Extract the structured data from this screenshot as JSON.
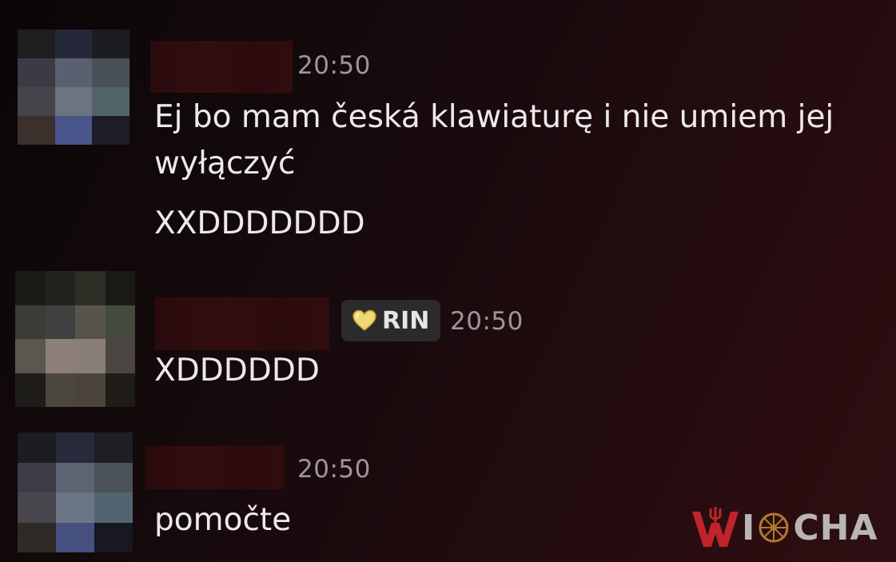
{
  "messages": [
    {
      "author_redacted": true,
      "time": "20:50",
      "lines": [
        "Ej bo mam česká klawiaturę i nie umiem jej",
        "wyłączyć",
        "XXDDDDDDD"
      ]
    },
    {
      "author_redacted": true,
      "role_tag": {
        "icon": "yellow-heart-icon",
        "label": "RIN"
      },
      "time": "20:50",
      "lines": [
        "XDDDDDD"
      ]
    },
    {
      "author_redacted": true,
      "time": "20:50",
      "lines": [
        "pomočte"
      ]
    }
  ],
  "watermark": {
    "text": "WIOCHA",
    "colors": {
      "accent": "#c0242a",
      "text": "#b9b5b6"
    }
  },
  "colors": {
    "background": "#1a090b",
    "timestamp": "#9c9799",
    "message_text": "#eceaea",
    "tag_background": "#2b2a2d"
  }
}
